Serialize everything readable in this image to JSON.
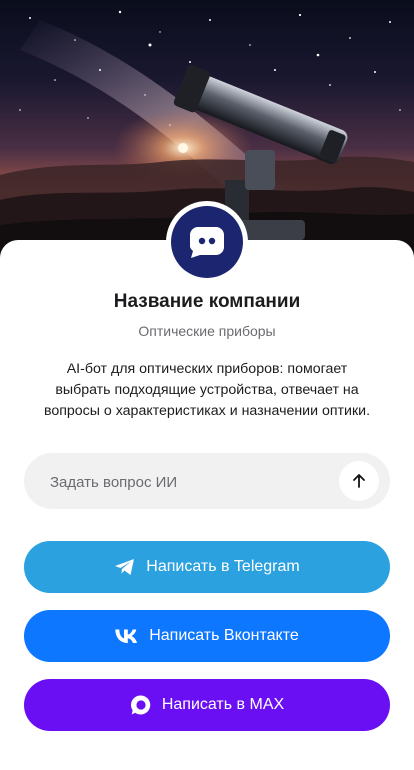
{
  "company": {
    "name": "Название компании",
    "category": "Оптические приборы",
    "description": "AI-бот для оптических приборов: помогает выбрать подходящие устройства, отвечает на вопросы о характеристиках и назначении оптики."
  },
  "ask": {
    "placeholder": "Задать вопрос ИИ",
    "value": "",
    "send_icon": "arrow-up-icon"
  },
  "buttons": [
    {
      "label": "Написать в Telegram",
      "icon": "telegram-icon",
      "color": "#2ca1e0"
    },
    {
      "label": "Написать Вконтакте",
      "icon": "vk-icon",
      "color": "#0d77ff"
    },
    {
      "label": "Написать в MAX",
      "icon": "max-icon",
      "color": "#6a0ff4"
    }
  ],
  "avatar": {
    "icon": "bot-icon",
    "color": "#1c2670"
  },
  "hero": {
    "image": "telescope-night-sky"
  }
}
